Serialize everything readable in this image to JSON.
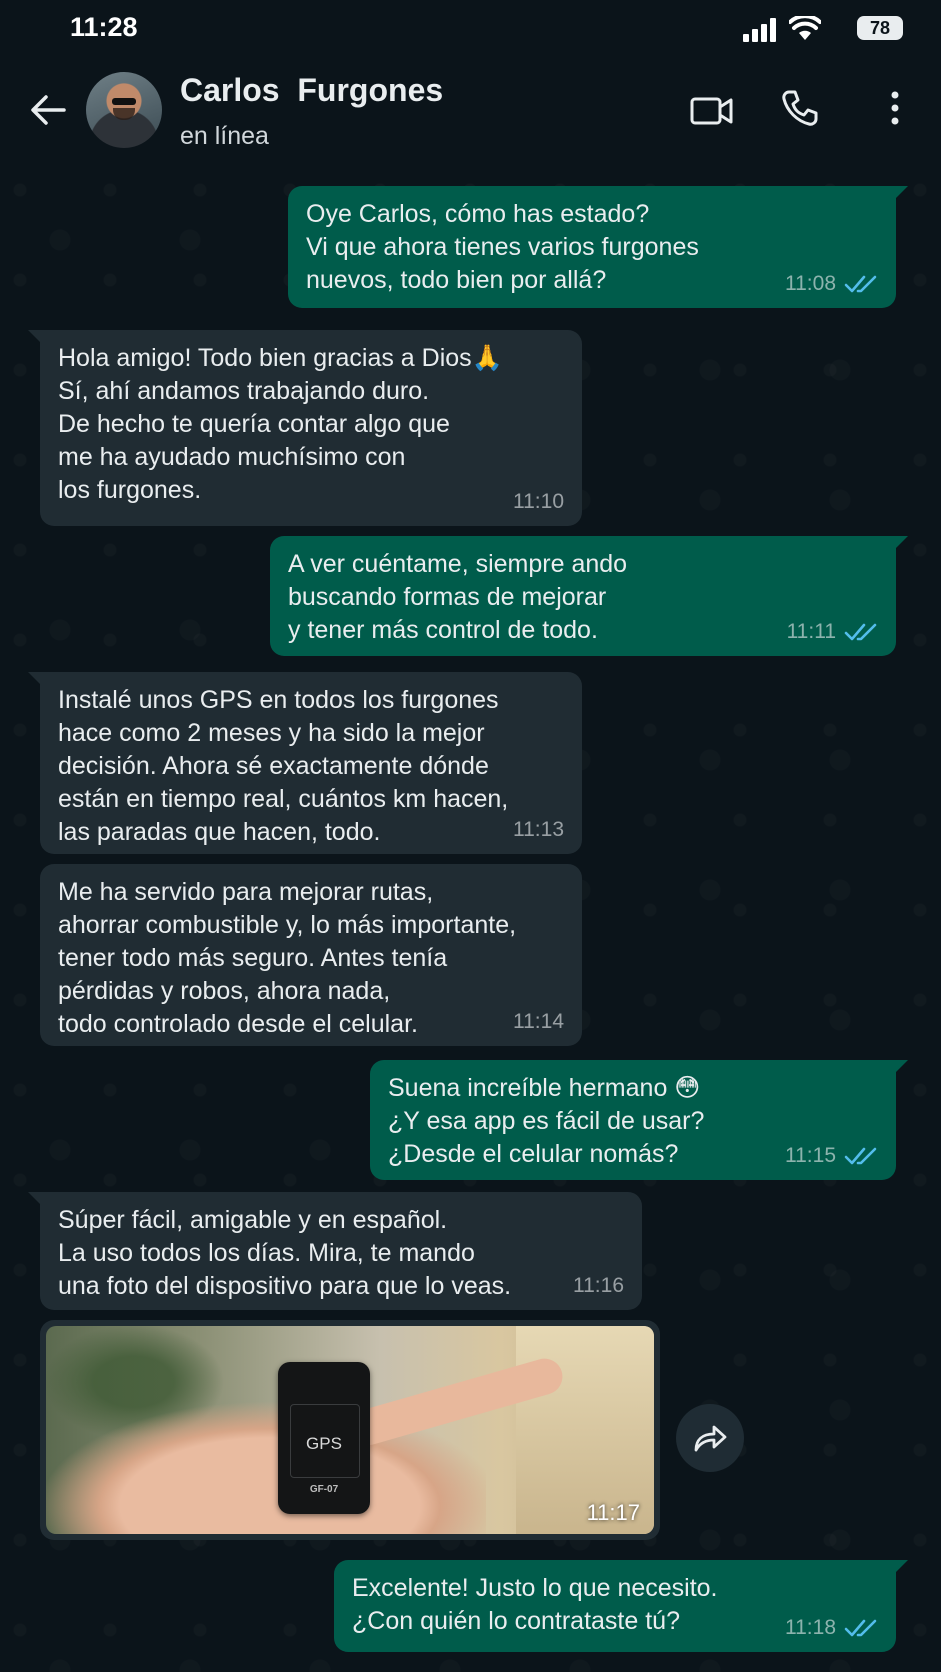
{
  "status_bar": {
    "time": "11:28",
    "battery": "78"
  },
  "header": {
    "name": "Carlos  Furgones",
    "status": "en línea"
  },
  "colors": {
    "outgoing": "#005c4b",
    "incoming": "#202c33",
    "read_ticks": "#53bdeb",
    "background": "#0b141a"
  },
  "messages": [
    {
      "dir": "out",
      "lines": [
        "Oye Carlos, cómo has estado?",
        "Vi que ahora tienes varios furgones",
        "nuevos, todo bien por allá?"
      ],
      "time": "11:08",
      "read": true
    },
    {
      "dir": "in",
      "lines": [
        "Hola amigo! Todo bien gracias a Dios🙏",
        "Sí, ahí andamos trabajando duro.",
        "De hecho te quería contar algo que",
        "me ha ayudado muchísimo con",
        "los furgones."
      ],
      "time": "11:10"
    },
    {
      "dir": "out",
      "lines": [
        "A ver cuéntame, siempre ando",
        "buscando formas de mejorar",
        "y tener más control de todo."
      ],
      "time": "11:11",
      "read": true
    },
    {
      "dir": "in",
      "lines": [
        "Instalé unos GPS en todos los furgones",
        "hace como 2 meses y ha sido la mejor",
        "decisión. Ahora sé exactamente dónde",
        "están en tiempo real, cuántos km hacen,",
        "las paradas que hacen, todo."
      ],
      "time": "11:13"
    },
    {
      "dir": "in",
      "lines": [
        "Me ha servido para mejorar rutas,",
        "ahorrar combustible y, lo más importante,",
        "tener todo más seguro. Antes tenía",
        "pérdidas y robos, ahora nada,",
        "todo controlado desde el celular."
      ],
      "time": "11:14"
    },
    {
      "dir": "out",
      "lines": [
        "Suena increíble hermano 😳",
        "¿Y esa app es fácil de usar?",
        "¿Desde el celular nomás?"
      ],
      "time": "11:15",
      "read": true
    },
    {
      "dir": "in",
      "lines": [
        "Súper fácil, amigable y en español.",
        "La uso todos los días. Mira, te mando",
        "una foto del dispositivo para que lo veas."
      ],
      "time": "11:16"
    },
    {
      "dir": "out",
      "lines": [
        "Excelente! Justo lo que necesito.",
        "¿Con quién lo contrataste tú?"
      ],
      "time": "11:18",
      "read": true
    }
  ],
  "image_message": {
    "device_label": "GPS",
    "device_model": "GF-07",
    "time": "11:17"
  }
}
